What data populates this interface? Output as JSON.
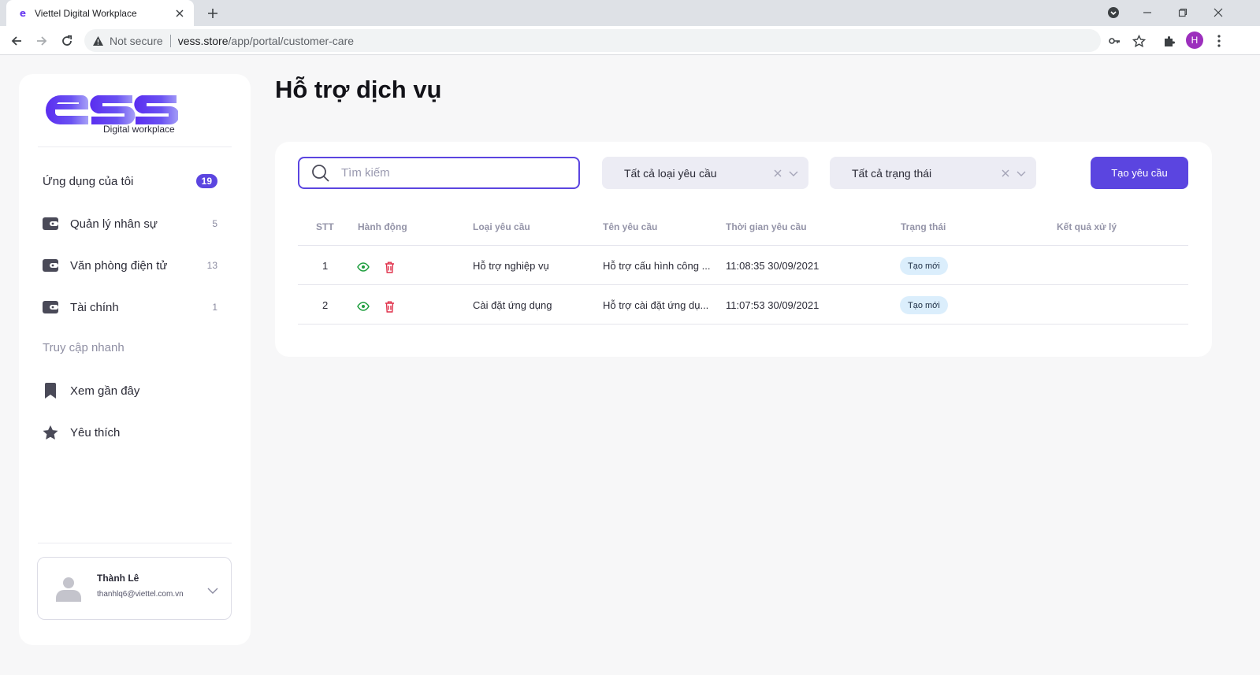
{
  "browser": {
    "tab_title": "Viettel Digital Workplace",
    "security_label": "Not secure",
    "url_host": "vess.store",
    "url_path": "/app/portal/customer-care",
    "profile_initial": "H"
  },
  "sidebar": {
    "logo_text": "ess",
    "logo_subtitle": "Digital workplace",
    "my_apps": {
      "label": "Ứng dụng của tôi",
      "count": "19"
    },
    "items": [
      {
        "label": "Quản lý nhân sự",
        "count": "5",
        "icon": "wallet-icon"
      },
      {
        "label": "Văn phòng điện tử",
        "count": "13",
        "icon": "wallet-icon"
      },
      {
        "label": "Tài chính",
        "count": "1",
        "icon": "wallet-icon"
      }
    ],
    "quick_access_title": "Truy cập nhanh",
    "quick_items": [
      {
        "label": "Xem gần đây",
        "icon": "bookmark-icon"
      },
      {
        "label": "Yêu thích",
        "icon": "star-icon"
      }
    ],
    "user": {
      "name": "Thành Lê",
      "email": "thanhlq6@viettel.com.vn"
    }
  },
  "main": {
    "title": "Hỗ trợ dịch vụ",
    "search_placeholder": "Tìm kiếm",
    "filter_type": "Tất cả loại yêu cầu",
    "filter_status": "Tất cả trạng thái",
    "create_button": "Tạo yêu cầu",
    "columns": [
      "STT",
      "Hành động",
      "Loại yêu cầu",
      "Tên yêu cầu",
      "Thời gian yêu cầu",
      "Trạng thái",
      "Kết quả xử lý"
    ],
    "rows": [
      {
        "stt": "1",
        "type": "Hỗ trợ nghiệp vụ",
        "name": "Hỗ trợ cấu hình công ...",
        "time": "11:08:35 30/09/2021",
        "status": "Tạo mới",
        "result": ""
      },
      {
        "stt": "2",
        "type": "Cài đặt ứng dụng",
        "name": "Hỗ trợ cài đặt ứng dụ...",
        "time": "11:07:53 30/09/2021",
        "status": "Tạo mới",
        "result": ""
      }
    ]
  },
  "colors": {
    "accent": "#5b45e0",
    "badge_bg": "#dbeefc",
    "view_icon": "#1e9e3e",
    "delete_icon": "#e0304a"
  }
}
